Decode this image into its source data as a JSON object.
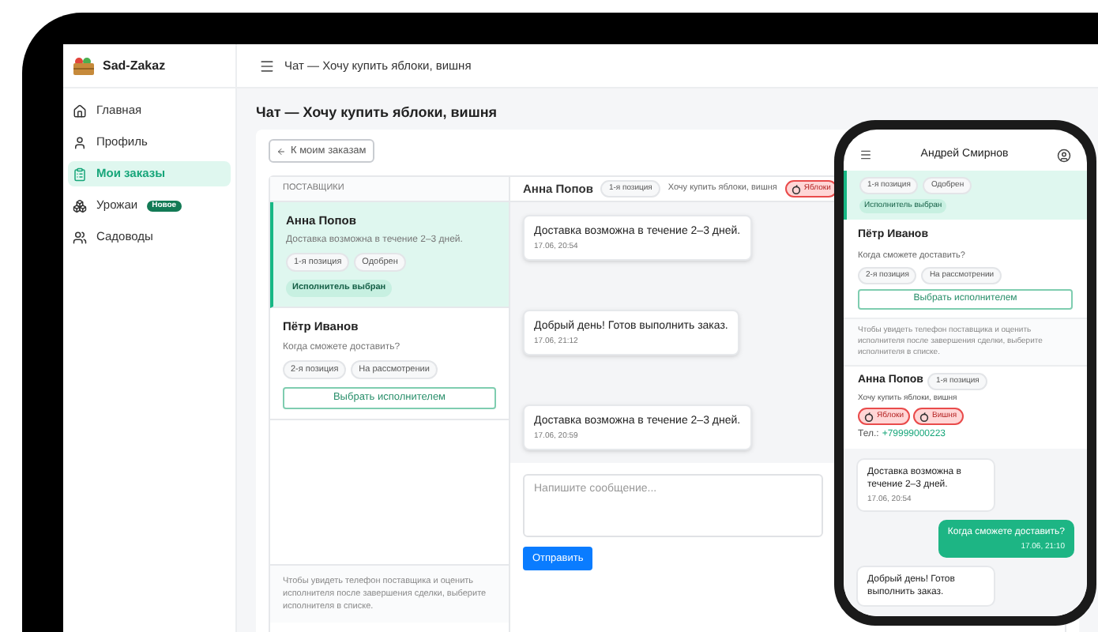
{
  "app": {
    "name": "Sad-Zakaz"
  },
  "sidebar": {
    "items": [
      {
        "label": "Главная",
        "kind": "home",
        "selected": false
      },
      {
        "label": "Профиль",
        "kind": "user",
        "selected": false
      },
      {
        "label": "Мои заказы",
        "kind": "orders",
        "selected": true
      },
      {
        "label": "Урожаи",
        "kind": "harvest",
        "selected": false,
        "badge": "Новое"
      },
      {
        "label": "Садоводы",
        "kind": "users",
        "selected": false
      }
    ]
  },
  "header": {
    "title": "Чат — Хочу купить яблоки, вишня"
  },
  "page": {
    "title": "Чат — Хочу купить яблоки, вишня",
    "back_button": "К моим заказам"
  },
  "suppliers": {
    "heading": "ПОСТАВЩИКИ",
    "items": [
      {
        "name": "Анна Попов",
        "message": "Доставка возможна в течение 2–3 дней.",
        "chips": [
          "1-я позиция",
          "Одобрен"
        ],
        "selected": true,
        "status": "Исполнитель выбран"
      },
      {
        "name": "Пётр Иванов",
        "message": "Когда сможете доставить?",
        "chips": [
          "2-я позиция",
          "На рассмотрении"
        ],
        "selected": false,
        "action": "Выбрать исполнителем"
      }
    ],
    "note": "Чтобы увидеть телефон поставщика и оценить исполнителя после завершения сделки, выберите исполнителя в списке."
  },
  "chat": {
    "name": "Анна Попов",
    "position": "1-я позиция",
    "order": "Хочу купить яблоки, вишня",
    "tags": [
      {
        "label": "Яблоки"
      }
    ],
    "messages": [
      {
        "text": "Доставка возможна в течение 2–3 дней.",
        "time": "17.06, 20:54",
        "outgoing": false
      },
      {
        "text": "Добрый день! Готов выполнить заказ.",
        "time": "17.06, 21:12",
        "outgoing": false
      },
      {
        "text": "Доставка возможна в течение 2–3 дней.",
        "time": "17.06, 20:59",
        "outgoing": false
      }
    ],
    "input": {
      "placeholder": "Напишите сообщение..."
    },
    "send_button": "Отправить"
  },
  "phone": {
    "title": "Андрей Смирнов",
    "selected_item": {
      "chips": [
        "1-я позиция",
        "Одобрен"
      ],
      "status": "Исполнитель выбран"
    },
    "supplier": {
      "name": "Пётр Иванов",
      "message": "Когда сможете доставить?",
      "chips": [
        "2-я позиция",
        "На рассмотрении"
      ],
      "action": "Выбрать исполнителем"
    },
    "note": "Чтобы увидеть телефон поставщика и оценить исполнителя после завершения сделки, выберите исполнителя в списке.",
    "contact": {
      "name": "Анна Попов",
      "position": "1-я позиция",
      "order": "Хочу купить яблоки, вишня",
      "tags": [
        {
          "label": "Яблоки"
        },
        {
          "label": "Вишня"
        }
      ],
      "phone_label": "Тел.:",
      "phone": "+79999000223"
    },
    "messages": [
      {
        "text": "Доставка возможна в течение 2–3 дней.",
        "time": "17.06, 20:54",
        "outgoing": false
      },
      {
        "text": "Когда сможете доставить?",
        "time": "17.06, 21:10",
        "outgoing": true
      },
      {
        "text": "Добрый день! Готов выполнить заказ.",
        "outgoing": false
      }
    ]
  }
}
